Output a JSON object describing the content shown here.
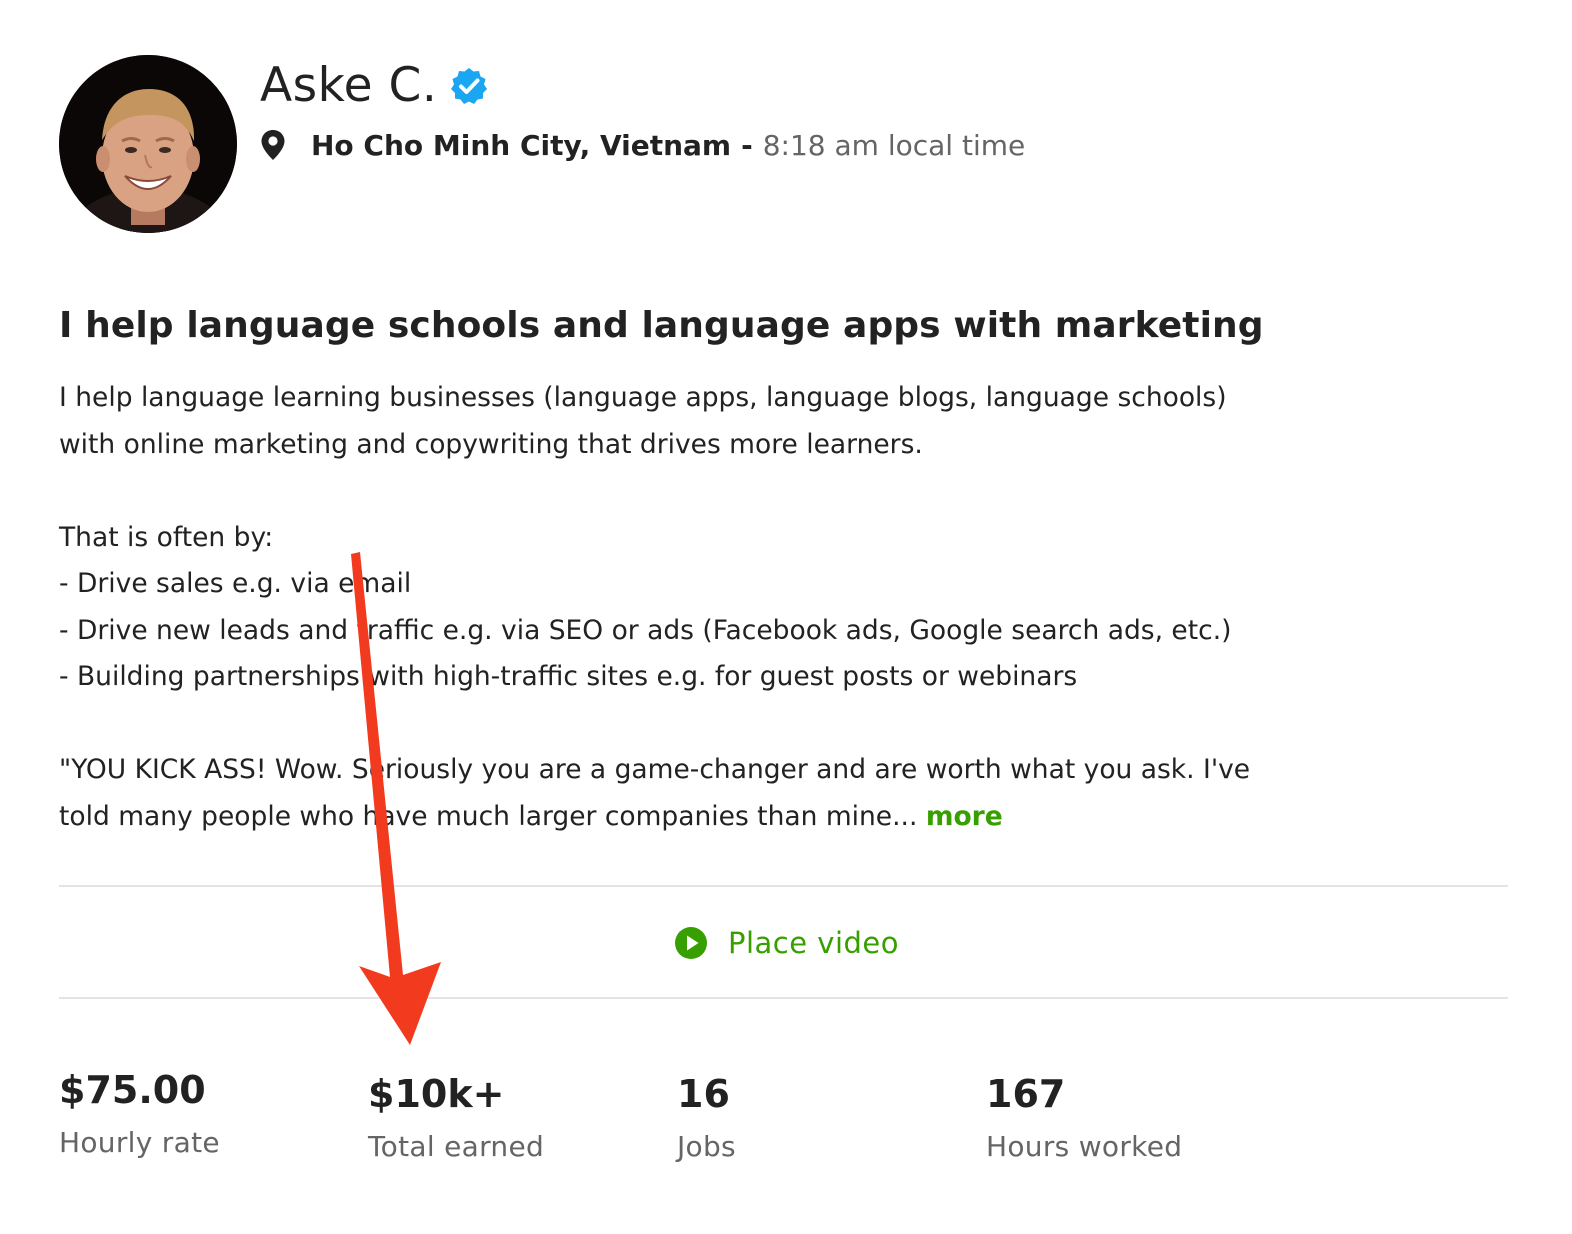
{
  "profile": {
    "name": "Aske C.",
    "verified_icon": "verified-check-icon",
    "location_icon": "map-pin-icon",
    "location": "Ho Cho Minh City, Vietnam",
    "separator": "-",
    "local_time": "8:18 am local time"
  },
  "overview": {
    "title": "I help language schools and language apps with marketing",
    "lines": [
      "I help language learning businesses (language apps, language blogs, language schools)",
      "with online marketing and copywriting that drives more learners.",
      "That is often by:",
      "- Drive sales e.g. via email",
      "- Drive new leads and traffic e.g. via SEO or ads (Facebook ads, Google search ads, etc.)",
      "- Building partnerships with high-traffic sites e.g. for guest posts or webinars",
      "\"YOU KICK ASS! Wow. Seriously you are a game-changer and are worth what you ask. I've",
      "told many people who have much larger companies than mine..."
    ],
    "more_link": "more"
  },
  "video": {
    "icon": "play-circle-icon",
    "label": "Place video"
  },
  "stats": [
    {
      "value": "$75.00",
      "label": "Hourly rate"
    },
    {
      "value": "$10k+",
      "label": "Total earned"
    },
    {
      "value": "16",
      "label": "Jobs"
    },
    {
      "value": "167",
      "label": "Hours worked"
    }
  ],
  "colors": {
    "accent_green": "#37a000",
    "verified_blue": "#1ba6f2",
    "annotation_red": "#f23a1f"
  }
}
